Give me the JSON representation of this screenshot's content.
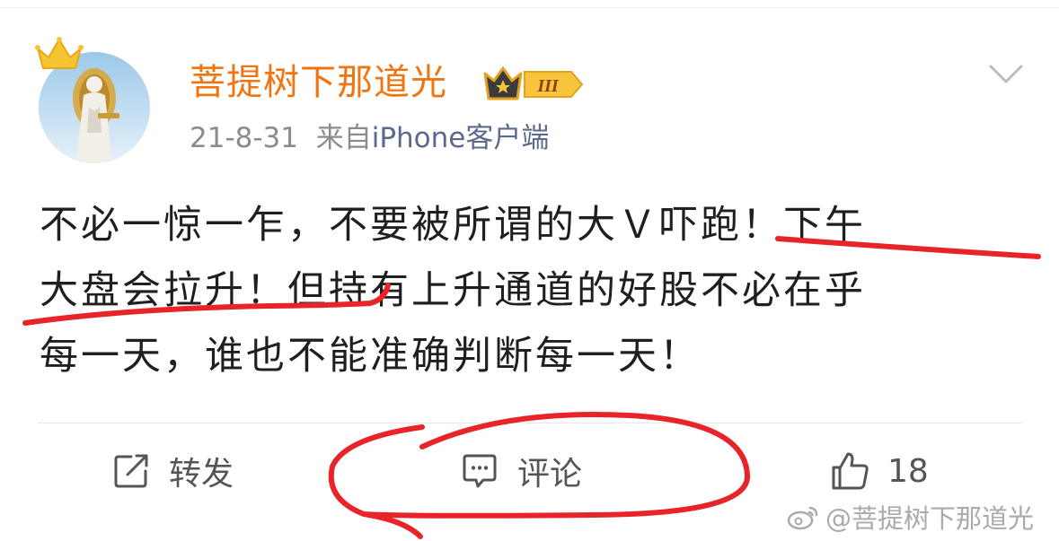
{
  "post": {
    "author": "菩提树下那道光",
    "vip_level": "III",
    "timestamp": "21-8-31",
    "source_prefix": "来自",
    "source": "iPhone客户端",
    "text_lines": [
      "不必一惊一乍，不要被所谓的大Ｖ吓跑！下午",
      "大盘会拉升！但持有上升通道的好股不必在乎",
      "每一天，谁也不能准确判断每一天！"
    ]
  },
  "actions": {
    "repost_label": "转发",
    "comment_label": "评论",
    "like_count": "18"
  },
  "watermark": "@菩提树下那道光",
  "colors": {
    "username": "#f0740f",
    "annotation": "#e8232a",
    "meta": "#8b8b8b"
  },
  "icons": [
    "crown-icon",
    "vip-crown-badge-icon",
    "chevron-down-icon",
    "repost-icon",
    "comment-icon",
    "thumbs-up-icon",
    "weibo-logo-icon"
  ]
}
